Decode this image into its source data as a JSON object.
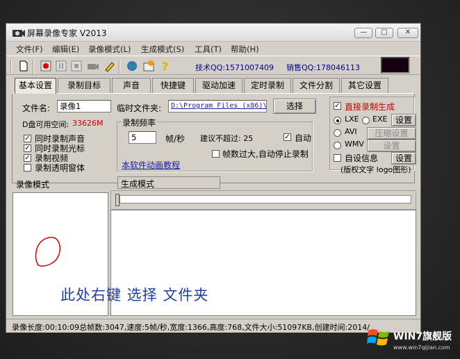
{
  "window": {
    "title": "屏幕录像专家 V2013",
    "minimize": "—",
    "maximize": "□",
    "close": "✕"
  },
  "menu": [
    "文件(F)",
    "编辑(E)",
    "录像模式(L)",
    "生成模式(S)",
    "工具(T)",
    "帮助(H)"
  ],
  "toolbar": {
    "tech_qq": "技术QQ:1571007409",
    "sales_qq": "销售QQ:178046113"
  },
  "tabs": [
    "基本设置",
    "录制目标",
    "声音",
    "快捷键",
    "驱动加速",
    "定时录制",
    "文件分割",
    "其它设置"
  ],
  "basic": {
    "filename_label": "文件名:",
    "filename_value": "录像1",
    "tempdir_label": "临时文件夹:",
    "tempdir_value": "D:\\Program Files (x86)\\",
    "choose_button": "选择",
    "disk_label": "D盘可用空间:",
    "disk_value": "33626M",
    "checks": [
      "同时录制声音",
      "同时录制光标",
      "录制视频",
      "录制透明窗体"
    ],
    "checks_state": [
      true,
      true,
      true,
      false
    ],
    "rate_group": "录制频率",
    "rate_value": "5",
    "rate_unit": "帧/秒",
    "rate_suggest": "建议不超过: 25",
    "auto_label": "自动",
    "stop_label": "帧数过大,自动停止录制",
    "tutorial_link": "本软件动画教程",
    "direct_label": "直接录制生成",
    "formats": [
      "LXE",
      "EXE",
      "AVI",
      "WMV"
    ],
    "settings_btn": "设置",
    "compress_btn": "压缩设置",
    "custom_label": "自设信息",
    "custom_note": "(版权文字 logo图形)"
  },
  "left_panel": {
    "header": "录像模式"
  },
  "right_panel": {
    "header": "生成模式"
  },
  "annotation": "此处右键 选择 文件夹",
  "status": "录像长度:00:10:09总帧数:3047,速度:5帧/秒,宽度:1366,高度:768,文件大小:51097KB,创建时间:2014/",
  "watermark": {
    "brand": "WIN7旗舰版",
    "site": "www.win7qijian.com"
  },
  "colors": {
    "red": "#cc0000",
    "link": "#1a1aa6",
    "annotation": "#1f3fa8",
    "accent_blue": "#0000a0"
  }
}
